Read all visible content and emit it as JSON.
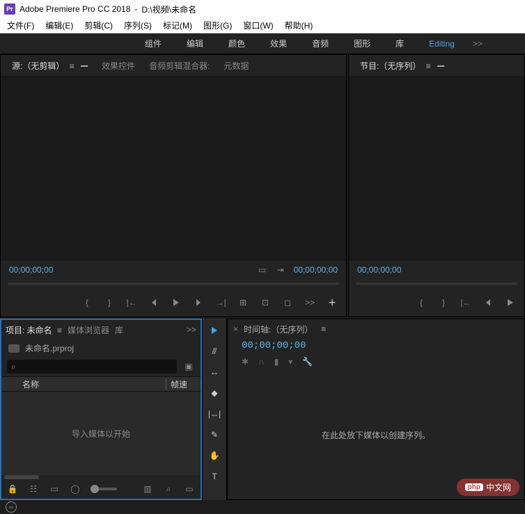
{
  "title": {
    "app": "Adobe Premiere Pro CC 2018",
    "sep": " - ",
    "path": "D:\\视频\\未命名",
    "icon_label": "Pr"
  },
  "menu": [
    "文件(F)",
    "编辑(E)",
    "剪辑(C)",
    "序列(S)",
    "标记(M)",
    "图形(G)",
    "窗口(W)",
    "帮助(H)"
  ],
  "workspaces": {
    "items": [
      "组件",
      "编辑",
      "颜色",
      "效果",
      "音频",
      "图形",
      "库",
      "Editing"
    ],
    "active_index": 7
  },
  "source": {
    "tabs": [
      "源:（无剪辑）",
      "效果控件",
      "音频剪辑混合器:",
      "元数据"
    ],
    "active": 0,
    "tc_left": "00;00;00;00",
    "tc_right": "00;00;00;00"
  },
  "program": {
    "title": "节目:（无序列）",
    "tc_left": "00;00;00;00"
  },
  "project": {
    "tabs": [
      "项目: 未命名",
      "媒体浏览器",
      "库"
    ],
    "filename": "未命名.prproj",
    "search_placeholder": "",
    "col_name": "名称",
    "col_fps": "帧速",
    "empty": "导入媒体以开始"
  },
  "timeline": {
    "title": "时间轴:（无序列）",
    "tc": "00;00;00;00",
    "drop_hint": "在此处放下媒体以创建序列。"
  },
  "watermark": {
    "badge": "php",
    "text": "中文网"
  },
  "ws_chev": ">>",
  "hamburger": "≡",
  "plus": "+",
  "search_glyph": "⌕"
}
